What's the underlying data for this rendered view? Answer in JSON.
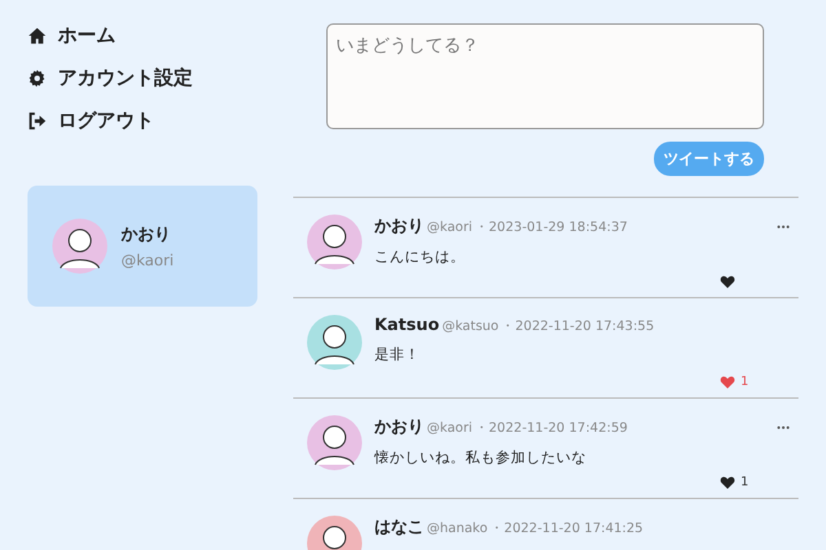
{
  "nav": [
    {
      "label": "ホーム"
    },
    {
      "label": "アカウント設定"
    },
    {
      "label": "ログアウト"
    }
  ],
  "profile": {
    "name": "かおり",
    "handle": "@kaori",
    "color": "#e8c0e4"
  },
  "composer": {
    "placeholder": "いまどうしてる？",
    "button": "ツイートする"
  },
  "tweets": [
    {
      "name": "かおり",
      "handle": "@kaori",
      "time": "・2023-01-29 18:54:37",
      "text": "こんにちは。",
      "color": "#e8c0e4",
      "has_menu": true,
      "liked": false
    },
    {
      "name": "Katsuo",
      "handle": "@katsuo",
      "time": "・2022-11-20 17:43:55",
      "text": "是非！",
      "color": "#a8e0e2",
      "has_menu": false,
      "liked": true,
      "likes": "1"
    },
    {
      "name": "かおり",
      "handle": "@kaori",
      "time": "・2022-11-20 17:42:59",
      "text": "懐かしいね。私も参加したいな",
      "color": "#e8c0e4",
      "has_menu": true,
      "liked": false,
      "likes": "1"
    },
    {
      "name": "はなこ",
      "handle": "@hanako",
      "time": "・2022-11-20 17:41:25",
      "color": "#f0b4b8"
    }
  ]
}
